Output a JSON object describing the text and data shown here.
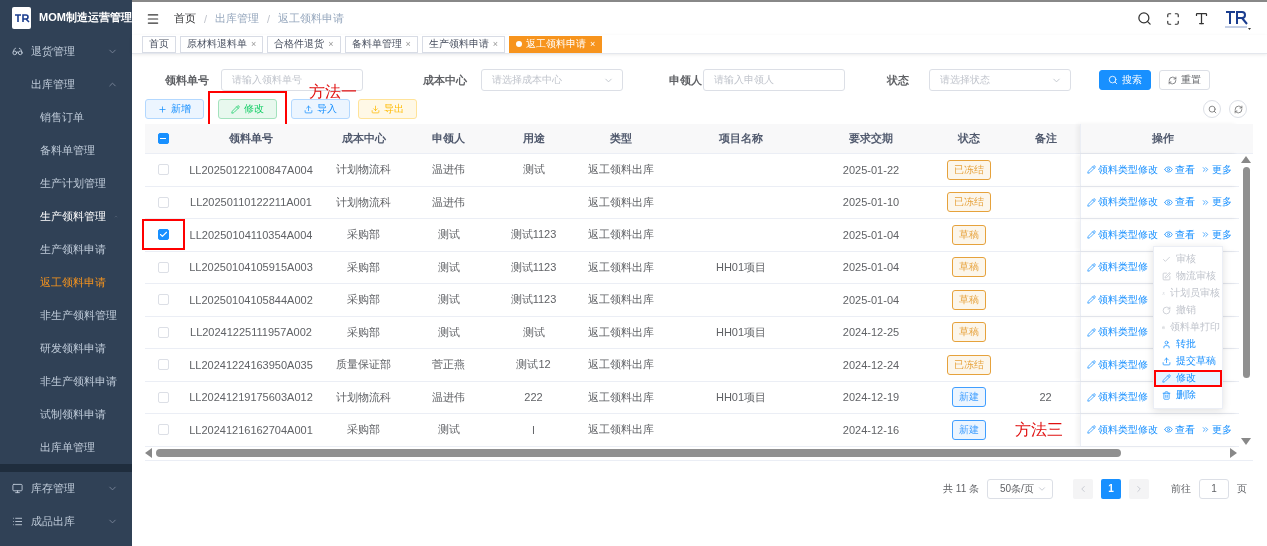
{
  "app": {
    "title": "MOM制造运营管理"
  },
  "sidebar": {
    "items": [
      {
        "label": "退货管理",
        "expanded": false,
        "selected": false,
        "active": false
      },
      {
        "label": "出库管理",
        "expanded": true,
        "selected": false,
        "active": false,
        "children": [
          {
            "label": "销售订单",
            "selected": false
          },
          {
            "label": "备料单管理",
            "selected": false
          },
          {
            "label": "生产计划管理",
            "selected": false
          },
          {
            "label": "生产领料管理",
            "expanded": true,
            "selected": false,
            "active": true,
            "children": [
              {
                "label": "生产领料申请",
                "selected": false
              },
              {
                "label": "返工领料申请",
                "selected": true
              }
            ]
          },
          {
            "label": "非生产领料管理",
            "expanded": true,
            "selected": false,
            "active": false,
            "children": [
              {
                "label": "研发领料申请",
                "selected": false
              },
              {
                "label": "非生产领料申请",
                "selected": false
              },
              {
                "label": "试制领料申请",
                "selected": false
              }
            ]
          },
          {
            "label": "出库单管理",
            "selected": false
          }
        ]
      },
      {
        "label": "库存管理",
        "expanded": false,
        "selected": false,
        "active": false
      },
      {
        "label": "成品出库",
        "expanded": false,
        "selected": false,
        "active": false
      }
    ]
  },
  "breadcrumb": [
    {
      "label": "首页"
    },
    {
      "separator": "/",
      "label": "出库管理"
    },
    {
      "separator": "/",
      "label": "返工领料申请"
    }
  ],
  "tabs": [
    {
      "label": "首页",
      "selected": false
    },
    {
      "label": "原材料退料单",
      "selected": false,
      "close": "×"
    },
    {
      "label": "合格件退货",
      "selected": false,
      "close": "×"
    },
    {
      "label": "备料单管理",
      "selected": false,
      "close": "×"
    },
    {
      "label": "生产领料申请",
      "selected": false,
      "close": "×"
    },
    {
      "label": "返工领料申请",
      "selected": true,
      "close": "×"
    }
  ],
  "filters": [
    {
      "label": "领料单号",
      "kind": "input",
      "placeholder": "请输入领料单号"
    },
    {
      "label": "成本中心",
      "kind": "select",
      "placeholder": "请选择成本中心"
    },
    {
      "label": "申领人",
      "kind": "input",
      "placeholder": "请输入申领人"
    },
    {
      "label": "状态",
      "kind": "select",
      "placeholder": "请选择状态"
    }
  ],
  "search_button": "搜索",
  "reset_button": "重置",
  "toolbar": [
    {
      "label": "新增",
      "kind": "add",
      "highlighted": false
    },
    {
      "label": "修改",
      "kind": "edit",
      "highlighted": true
    },
    {
      "label": "导入",
      "kind": "import",
      "highlighted": false
    },
    {
      "label": "导出",
      "kind": "export",
      "highlighted": false
    }
  ],
  "annotations": [
    {
      "text": "方法一"
    },
    {
      "text": "方法三"
    }
  ],
  "table": {
    "header_checkbox": {
      "indeterminate": true
    },
    "columns": [
      "领料单号",
      "成本中心",
      "申领人",
      "用途",
      "类型",
      "项目名称",
      "要求交期",
      "状态",
      "备注",
      "操作"
    ],
    "rows": [
      {
        "selected": false,
        "highlighted": false,
        "cells": [
          "LL20250122100847A004",
          "计划物流科",
          "温进伟",
          "测试",
          "返工领料出库",
          "",
          "2025-01-22"
        ],
        "status": {
          "label": "已冻结",
          "color": "#e6a23c"
        },
        "remark": "",
        "ops": [
          {
            "label": "领料类型修改",
            "kind": "edit"
          },
          {
            "label": "查看",
            "kind": "view"
          },
          {
            "label": "更多",
            "kind": "more"
          }
        ]
      },
      {
        "selected": false,
        "highlighted": false,
        "cells": [
          "LL20250110122211A001",
          "计划物流科",
          "温进伟",
          "",
          "返工领料出库",
          "",
          "2025-01-10"
        ],
        "status": {
          "label": "已冻结",
          "color": "#e6a23c"
        },
        "remark": "",
        "ops": [
          {
            "label": "领料类型修改",
            "kind": "edit"
          },
          {
            "label": "查看",
            "kind": "view"
          },
          {
            "label": "更多",
            "kind": "more"
          }
        ]
      },
      {
        "selected": true,
        "highlighted": true,
        "cells": [
          "LL20250104110354A004",
          "采购部",
          "测试",
          "测试1123",
          "返工领料出库",
          "",
          "2025-01-04"
        ],
        "status": {
          "label": "草稿",
          "color": "#e6a23c"
        },
        "remark": "",
        "ops": [
          {
            "label": "领料类型修改",
            "kind": "edit"
          },
          {
            "label": "查看",
            "kind": "view"
          },
          {
            "label": "更多",
            "kind": "more"
          }
        ]
      },
      {
        "selected": false,
        "highlighted": false,
        "cells": [
          "LL20250104105915A003",
          "采购部",
          "测试",
          "测试1123",
          "返工领料出库",
          "HH01项目",
          "2025-01-04"
        ],
        "status": {
          "label": "草稿",
          "color": "#e6a23c"
        },
        "remark": "",
        "ops": [
          {
            "label": "领料类型修",
            "kind": "edit"
          }
        ]
      },
      {
        "selected": false,
        "highlighted": false,
        "cells": [
          "LL20250104105844A002",
          "采购部",
          "测试",
          "测试1123",
          "返工领料出库",
          "",
          "2025-01-04"
        ],
        "status": {
          "label": "草稿",
          "color": "#e6a23c"
        },
        "remark": "",
        "ops": [
          {
            "label": "领料类型修",
            "kind": "edit"
          }
        ]
      },
      {
        "selected": false,
        "highlighted": false,
        "cells": [
          "LL20241225111957A002",
          "采购部",
          "测试",
          "测试",
          "返工领料出库",
          "HH01项目",
          "2024-12-25"
        ],
        "status": {
          "label": "草稿",
          "color": "#e6a23c"
        },
        "remark": "",
        "ops": [
          {
            "label": "领料类型修",
            "kind": "edit"
          }
        ]
      },
      {
        "selected": false,
        "highlighted": false,
        "cells": [
          "LL20241224163950A035",
          "质量保证部",
          "菅正燕",
          "测试12",
          "返工领料出库",
          "",
          "2024-12-24"
        ],
        "status": {
          "label": "已冻结",
          "color": "#e6a23c"
        },
        "remark": "",
        "ops": [
          {
            "label": "领料类型修",
            "kind": "edit"
          }
        ]
      },
      {
        "selected": false,
        "highlighted": false,
        "cells": [
          "LL20241219175603A012",
          "计划物流科",
          "温进伟",
          "222",
          "返工领料出库",
          "HH01项目",
          "2024-12-19"
        ],
        "status": {
          "label": "新建",
          "color": "#409eff"
        },
        "remark": "22",
        "ops": [
          {
            "label": "领料类型修",
            "kind": "edit"
          }
        ]
      },
      {
        "selected": false,
        "highlighted": false,
        "cells": [
          "LL20241216162704A001",
          "采购部",
          "测试",
          "l",
          "返工领料出库",
          "",
          "2024-12-16"
        ],
        "status": {
          "label": "新建",
          "color": "#409eff"
        },
        "remark": "",
        "ops": [
          {
            "label": "领料类型修改",
            "kind": "edit"
          },
          {
            "label": "查看",
            "kind": "view"
          },
          {
            "label": "更多",
            "kind": "more"
          }
        ]
      }
    ]
  },
  "more_menu": [
    {
      "label": "审核",
      "kind": "check",
      "disabled": true,
      "hovered": false,
      "highlighted": false
    },
    {
      "label": "物流审核",
      "kind": "edit-box",
      "disabled": true,
      "hovered": false,
      "highlighted": false
    },
    {
      "label": "计划员审核",
      "kind": "user",
      "disabled": true,
      "hovered": false,
      "highlighted": false
    },
    {
      "label": "撤销",
      "kind": "undo",
      "disabled": true,
      "hovered": false,
      "highlighted": false
    },
    {
      "label": "领料单打印",
      "kind": "print",
      "disabled": true,
      "hovered": false,
      "highlighted": false
    },
    {
      "label": "转批",
      "kind": "user",
      "disabled": false,
      "hovered": false,
      "highlighted": false
    },
    {
      "label": "提交草稿",
      "kind": "upload",
      "disabled": false,
      "hovered": false,
      "highlighted": false
    },
    {
      "label": "修改",
      "kind": "edit",
      "disabled": false,
      "hovered": true,
      "highlighted": true
    },
    {
      "label": "删除",
      "kind": "delete",
      "disabled": false,
      "hovered": false,
      "highlighted": false
    }
  ],
  "pagination": {
    "total": "共 11 条",
    "page_size": "50条/页",
    "pages": [
      {
        "label": "1",
        "selected": true
      }
    ],
    "goto_label": "前往",
    "goto_value": "1",
    "goto_suffix": "页"
  }
}
